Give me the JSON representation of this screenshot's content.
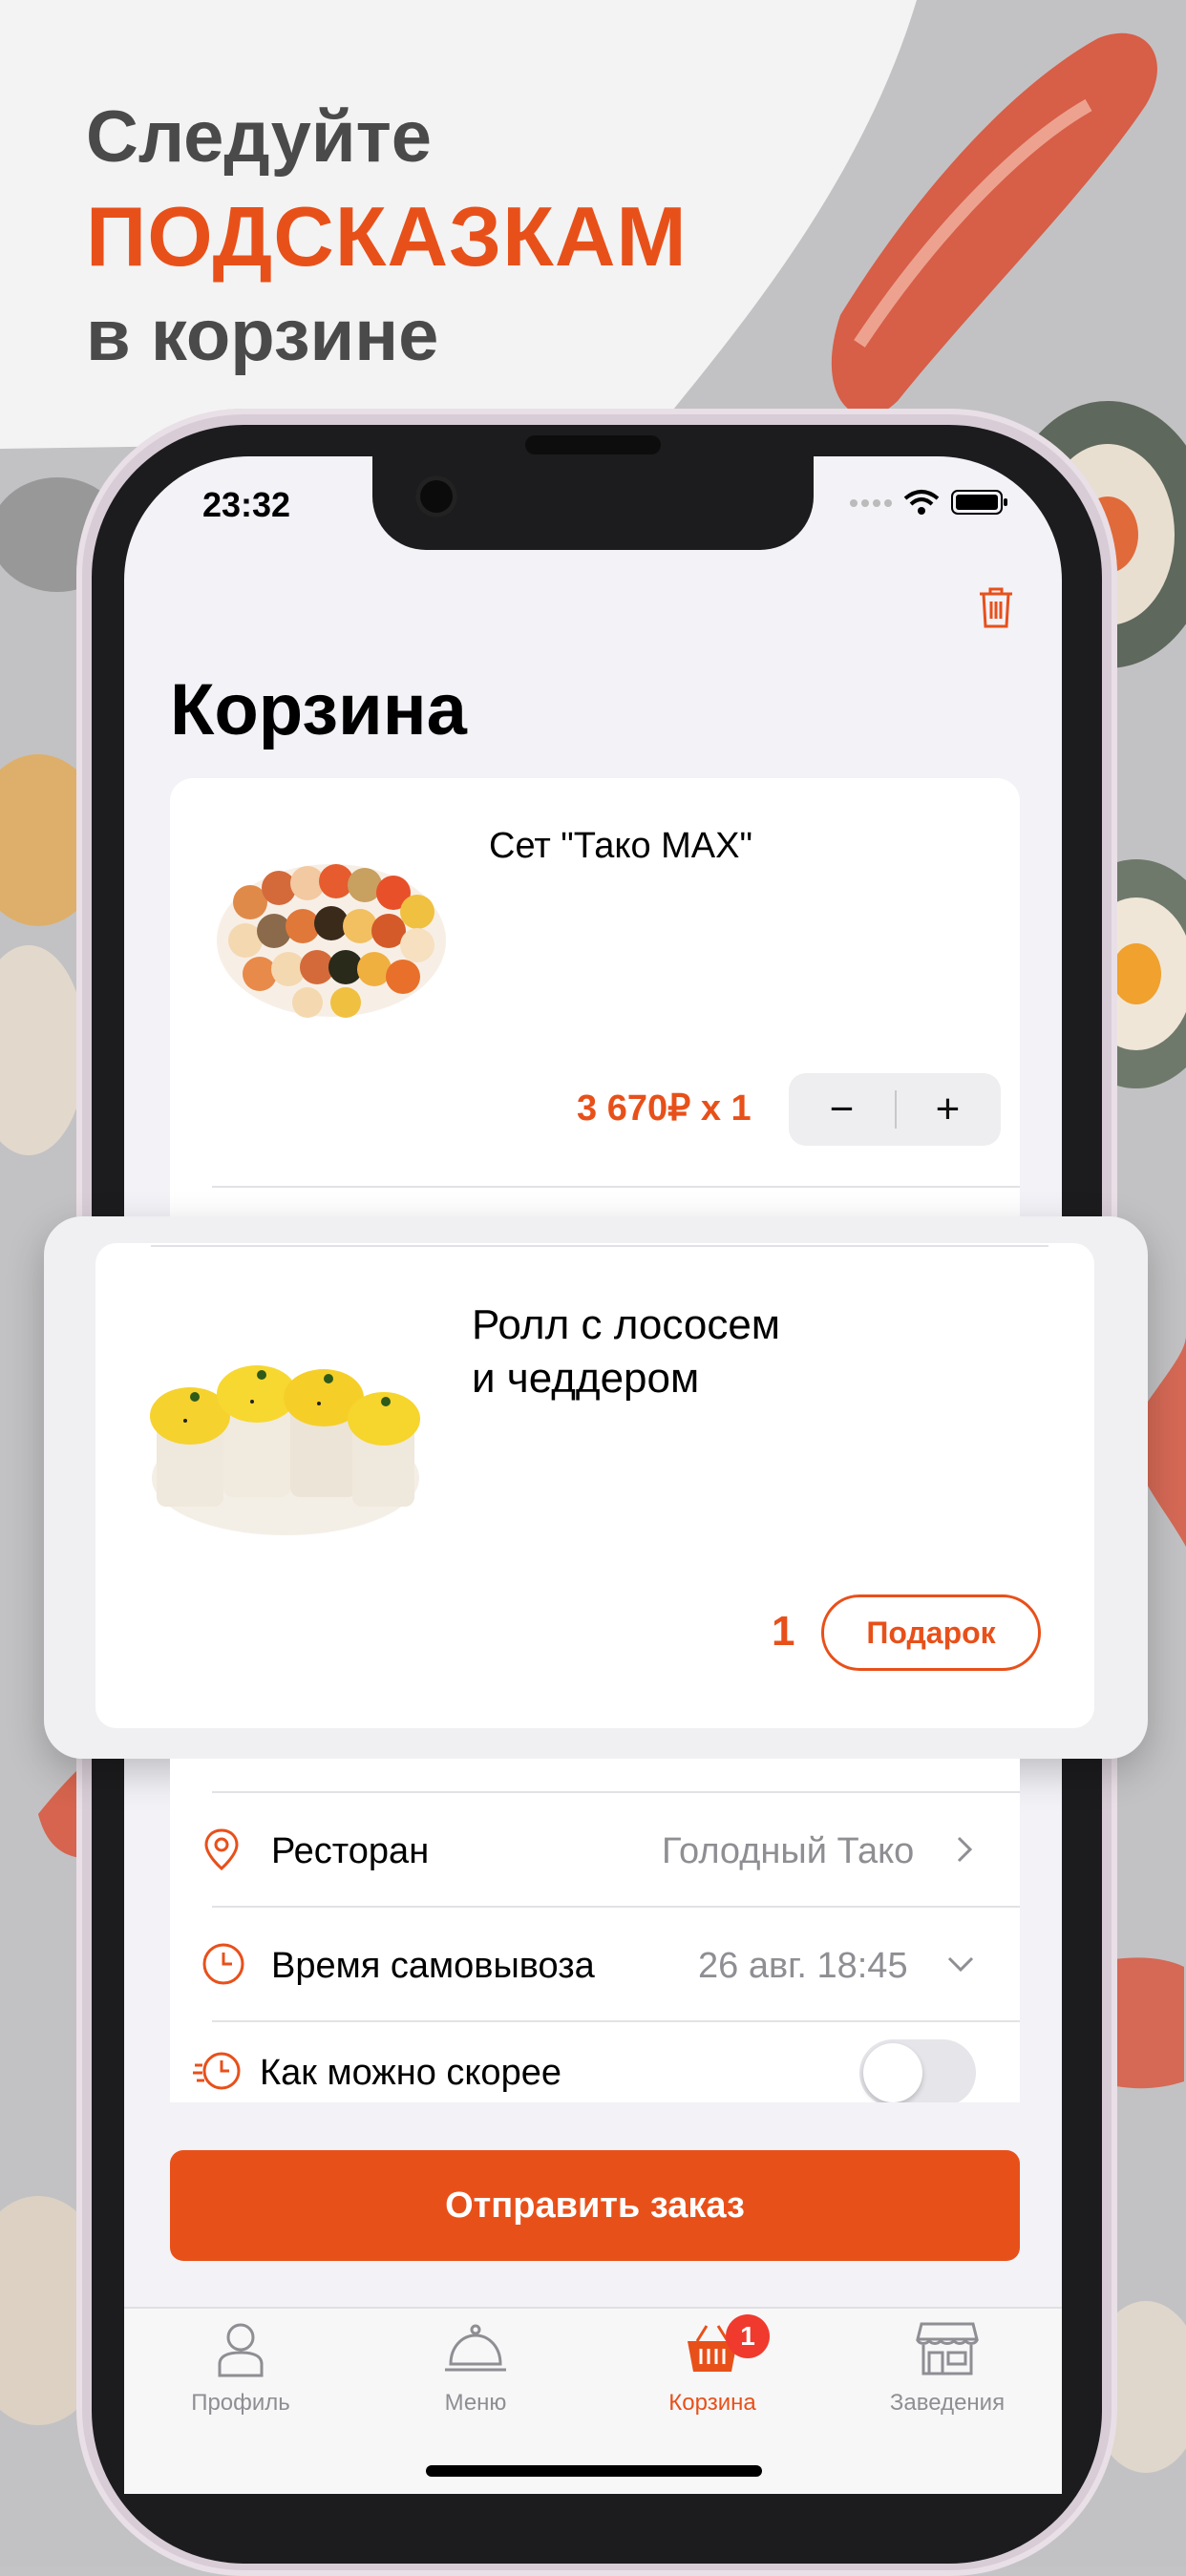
{
  "headline": {
    "line1": "Следуйте",
    "line2": "ПОДСКАЗКАМ",
    "line3": "в корзине"
  },
  "status_bar": {
    "time": "23:32"
  },
  "cart": {
    "title": "Корзина",
    "items": [
      {
        "name": "Сет \"Тако MAX\"",
        "price_qty": "3 670₽ x 1",
        "minus": "−",
        "plus": "+"
      }
    ],
    "gift_item": {
      "name_line1": "Ролл с лососем",
      "name_line2": "и чеддером",
      "qty": "1",
      "gift_label": "Подарок"
    },
    "restaurant": {
      "label": "Ресторан",
      "value": "Голодный Тако"
    },
    "pickup_time": {
      "label": "Время самовывоза",
      "value": "26 авг. 18:45"
    },
    "asap": {
      "label": "Как можно скорее",
      "enabled": false
    },
    "submit_label": "Отправить заказ"
  },
  "tabbar": {
    "tabs": [
      {
        "label": "Профиль",
        "icon": "profile-icon"
      },
      {
        "label": "Меню",
        "icon": "cloche-icon"
      },
      {
        "label": "Корзина",
        "icon": "basket-icon",
        "active": true,
        "badge": "1"
      },
      {
        "label": "Заведения",
        "icon": "store-icon"
      }
    ]
  },
  "colors": {
    "accent": "#e8501a",
    "badge": "#f03a2e"
  }
}
